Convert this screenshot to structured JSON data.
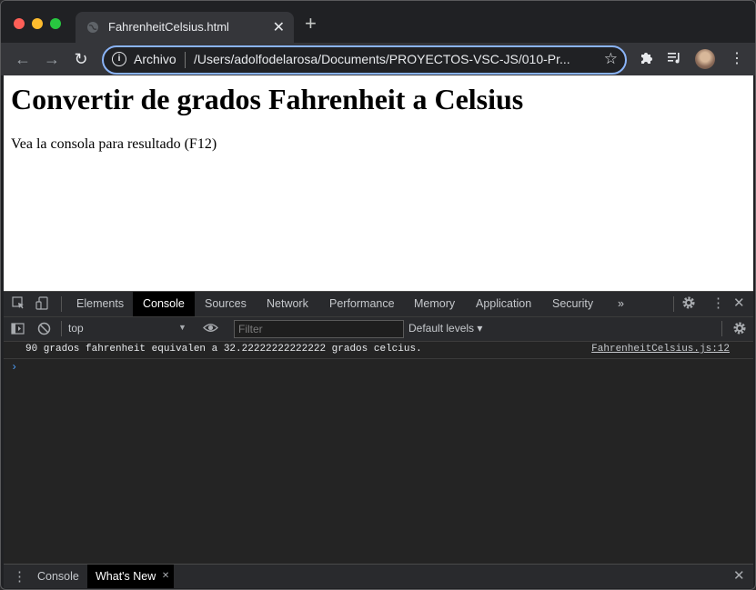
{
  "browser": {
    "tab_title": "FahrenheitCelsius.html",
    "tab_close": "✕",
    "new_tab": "+",
    "scheme_label": "Archivo",
    "url": "/Users/adolfodelarosa/Documents/PROYECTOS-VSC-JS/010-Pr...",
    "back": "←",
    "forward": "→",
    "reload": "↻",
    "star": "☆",
    "menu": "⋮"
  },
  "page": {
    "heading": "Convertir de grados Fahrenheit a Celsius",
    "paragraph": "Vea la consola para resultado (F12)"
  },
  "devtools": {
    "tabs": [
      "Elements",
      "Console",
      "Sources",
      "Network",
      "Performance",
      "Memory",
      "Application",
      "Security"
    ],
    "active_tab": "Console",
    "more": "»",
    "context": "top",
    "filter_placeholder": "Filter",
    "levels": "Default levels ▾",
    "log_message": "90 grados fahrenheit equivalen a 32.22222222222222 grados celcius.",
    "log_source": "FahrenheitCelsius.js:12",
    "prompt": "›",
    "drawer_tabs": [
      "Console",
      "What's New"
    ],
    "drawer_close_new": "✕"
  },
  "icons": {
    "globe": "globe-icon",
    "info": "info-icon",
    "extensions": "puzzle-icon",
    "media": "playlist-icon",
    "settings": "gear-icon"
  }
}
